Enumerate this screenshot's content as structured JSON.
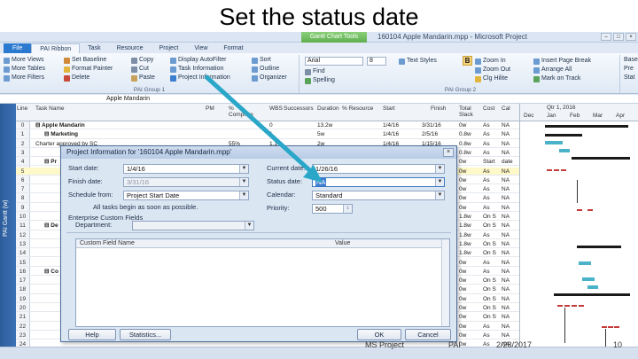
{
  "slide": {
    "title": "Set the status date",
    "footer_center": "MS Project",
    "footer_org": "PAI",
    "footer_date": "2/28/2017",
    "footer_page": "10"
  },
  "window": {
    "title": "160104 Apple Mandarin.mpp - Microsoft Project",
    "context_tab": "Gantt Chart Tools",
    "controls": [
      "–",
      "□",
      "×"
    ]
  },
  "tabs": [
    "File",
    "PAI Ribbon",
    "Task",
    "Resource",
    "Project",
    "View",
    "Format"
  ],
  "ribbon": {
    "group1": {
      "label": "PAI Group 1",
      "buttons": [
        "More Views",
        "More Tables",
        "More Filters",
        "Set Baseline",
        "Format Painter",
        "Delete",
        "Copy",
        "Cut",
        "Paste",
        "Display AutoFilter",
        "Task Information",
        "Project Information",
        "Sort",
        "Outline",
        "Organizer"
      ]
    },
    "group2": {
      "label": "PAI Group 2",
      "font": "Arial",
      "size": "8",
      "buttons": [
        "Text Styles",
        "Find",
        "Spelling",
        "Zoom In",
        "Zoom Out",
        "Clg Hilite",
        "Insert Page Break",
        "Arrange All",
        "Mark on Track"
      ]
    },
    "group3_buttons": [
      "Base",
      "Pre",
      "Stat"
    ]
  },
  "formula_bar": {
    "value": "Apple Mandarin"
  },
  "side_tab": "PAI Gantt (w)",
  "table": {
    "headers": [
      "Line",
      "Task Name",
      "PM",
      "% Complete",
      "WBS",
      "Successors",
      "Duration",
      "% Resource",
      "Start",
      "Finish",
      "Total Slack",
      "Cost",
      "Cal"
    ],
    "rows": [
      {
        "n": "0",
        "name": "Apple Mandarin",
        "pm": "",
        "pct": "",
        "wbs": "0",
        "dur": "13.2w",
        "start": "1/4/16",
        "finish": "3/31/16",
        "slack": "0w",
        "cost": "As",
        "cal": "NA",
        "summary": true
      },
      {
        "n": "1",
        "name": "Marketing",
        "pm": "",
        "pct": "",
        "wbs": "1",
        "dur": "5w",
        "start": "1/4/16",
        "finish": "2/5/16",
        "slack": "0.8w",
        "cost": "As",
        "cal": "NA",
        "summary": true
      },
      {
        "n": "2",
        "name": "Charter approved by SC",
        "pm": "",
        "pct": "55%",
        "wbs": "1.1",
        "dur": "2w",
        "start": "1/4/16",
        "finish": "1/15/16",
        "slack": "0.8w",
        "cost": "As",
        "cal": "NA"
      },
      {
        "n": "3",
        "name": "",
        "pm": "",
        "pct": "",
        "wbs": "",
        "dur": "",
        "start": "",
        "finish": "",
        "slack": "0.8w",
        "cost": "As",
        "cal": "NA"
      },
      {
        "n": "4",
        "name": "Pr",
        "pm": "",
        "pct": "",
        "wbs": "",
        "dur": "",
        "start": "",
        "finish": "",
        "slack": "0w",
        "cost": "Start",
        "cal": "date",
        "summary": true
      },
      {
        "n": "5",
        "name": "",
        "pm": "",
        "pct": "",
        "wbs": "",
        "dur": "",
        "start": "",
        "finish": "",
        "slack": "0w",
        "cost": "As",
        "cal": "NA",
        "hl": true
      },
      {
        "n": "6",
        "name": "",
        "pm": "",
        "pct": "",
        "wbs": "",
        "dur": "",
        "start": "",
        "finish": "",
        "slack": "0w",
        "cost": "As",
        "cal": "NA"
      },
      {
        "n": "7",
        "name": "",
        "pm": "",
        "pct": "",
        "wbs": "",
        "dur": "",
        "start": "",
        "finish": "",
        "slack": "0w",
        "cost": "As",
        "cal": "NA"
      },
      {
        "n": "8",
        "name": "",
        "pm": "",
        "pct": "",
        "wbs": "",
        "dur": "",
        "start": "",
        "finish": "",
        "slack": "0w",
        "cost": "As",
        "cal": "NA"
      },
      {
        "n": "9",
        "name": "",
        "pm": "",
        "pct": "",
        "wbs": "",
        "dur": "",
        "start": "",
        "finish": "",
        "slack": "0w",
        "cost": "As",
        "cal": "NA"
      },
      {
        "n": "10",
        "name": "",
        "pm": "",
        "pct": "",
        "wbs": "",
        "dur": "",
        "start": "",
        "finish": "",
        "slack": "1.8w",
        "cost": "On S",
        "cal": "NA"
      },
      {
        "n": "11",
        "name": "De",
        "pm": "",
        "pct": "",
        "wbs": "",
        "dur": "",
        "start": "",
        "finish": "",
        "slack": "1.8w",
        "cost": "On S",
        "cal": "NA",
        "summary": true
      },
      {
        "n": "12",
        "name": "",
        "pm": "",
        "pct": "",
        "wbs": "",
        "dur": "",
        "start": "",
        "finish": "",
        "slack": "1.8w",
        "cost": "As",
        "cal": "NA"
      },
      {
        "n": "13",
        "name": "",
        "pm": "",
        "pct": "",
        "wbs": "",
        "dur": "",
        "start": "",
        "finish": "",
        "slack": "1.8w",
        "cost": "On S",
        "cal": "NA"
      },
      {
        "n": "14",
        "name": "",
        "pm": "",
        "pct": "",
        "wbs": "",
        "dur": "",
        "start": "",
        "finish": "",
        "slack": "1.8w",
        "cost": "On S",
        "cal": "NA"
      },
      {
        "n": "15",
        "name": "",
        "pm": "",
        "pct": "",
        "wbs": "",
        "dur": "",
        "start": "",
        "finish": "",
        "slack": "0w",
        "cost": "As",
        "cal": "NA"
      },
      {
        "n": "16",
        "name": "Co",
        "pm": "",
        "pct": "",
        "wbs": "",
        "dur": "",
        "start": "",
        "finish": "",
        "slack": "0w",
        "cost": "As",
        "cal": "NA",
        "summary": true
      },
      {
        "n": "17",
        "name": "",
        "pm": "",
        "pct": "",
        "wbs": "",
        "dur": "",
        "start": "",
        "finish": "",
        "slack": "0w",
        "cost": "On S",
        "cal": "NA"
      },
      {
        "n": "18",
        "name": "",
        "pm": "",
        "pct": "",
        "wbs": "",
        "dur": "",
        "start": "",
        "finish": "",
        "slack": "0w",
        "cost": "On S",
        "cal": "NA"
      },
      {
        "n": "19",
        "name": "",
        "pm": "",
        "pct": "",
        "wbs": "",
        "dur": "",
        "start": "",
        "finish": "",
        "slack": "0w",
        "cost": "On S",
        "cal": "NA"
      },
      {
        "n": "20",
        "name": "",
        "pm": "",
        "pct": "",
        "wbs": "",
        "dur": "",
        "start": "",
        "finish": "",
        "slack": "0w",
        "cost": "On S",
        "cal": "NA"
      },
      {
        "n": "21",
        "name": "",
        "pm": "",
        "pct": "",
        "wbs": "",
        "dur": "",
        "start": "",
        "finish": "",
        "slack": "0w",
        "cost": "On S",
        "cal": "NA"
      },
      {
        "n": "22",
        "name": "",
        "pm": "",
        "pct": "",
        "wbs": "",
        "dur": "",
        "start": "",
        "finish": "",
        "slack": "0w",
        "cost": "As",
        "cal": "NA"
      },
      {
        "n": "23",
        "name": "",
        "pm": "",
        "pct": "",
        "wbs": "",
        "dur": "",
        "start": "",
        "finish": "",
        "slack": "0w",
        "cost": "As",
        "cal": "NA"
      },
      {
        "n": "24",
        "name": "",
        "pm": "",
        "pct": "",
        "wbs": "",
        "dur": "",
        "start": "",
        "finish": "",
        "slack": "0w",
        "cost": "As",
        "cal": "NA"
      },
      {
        "n": "25",
        "name": "",
        "pm": "",
        "pct": "",
        "wbs": "",
        "dur": "",
        "start": "",
        "finish": "",
        "slack": "0w",
        "cost": "As",
        "cal": "NA"
      }
    ]
  },
  "gantt_header": {
    "top": "Qtr 1, 2016",
    "months": [
      "Dec",
      "Jan",
      "Feb",
      "Mar",
      "Apr"
    ]
  },
  "dialog": {
    "title": "Project Information for '160104 Apple Mandarin.mpp'",
    "close": "×",
    "start_date_label": "Start date:",
    "start_date_value": "1/4/16",
    "finish_date_label": "Finish date:",
    "finish_date_value": "3/31/16",
    "schedule_from_label": "Schedule from:",
    "schedule_from_value": "Project Start Date",
    "schedule_note": "All tasks begin as soon as possible.",
    "current_date_label": "Current date:",
    "current_date_value": "1/26/16",
    "status_date_label": "Status date:",
    "status_date_value": "NA",
    "calendar_label": "Calendar:",
    "calendar_value": "Standard",
    "priority_label": "Priority:",
    "priority_value": "500",
    "custom_fields_label": "Enterprise Custom Fields",
    "department_label": "Department:",
    "grid_headers": [
      "Custom Field Name",
      "Value"
    ],
    "help_button": "Help",
    "statistics_button": "Statistics...",
    "ok_button": "OK",
    "cancel_button": "Cancel"
  },
  "colors": {
    "accent": "#2b7ad0",
    "arrow": "#2aa7c8",
    "task_bar": "#4bb3c9",
    "slack_line": "#c43b3b"
  }
}
